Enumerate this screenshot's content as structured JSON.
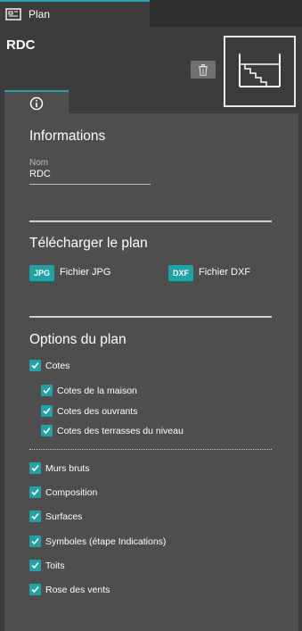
{
  "tab": {
    "label": "Plan",
    "icon": "plan-icon"
  },
  "level": {
    "title": "RDC",
    "delete_icon": "trash-icon",
    "thumbnail_icon": "floor-plan-thumbnail"
  },
  "info_tab": {
    "icon": "info-icon"
  },
  "informations": {
    "heading": "Informations",
    "name_label": "Nom",
    "name_value": "RDC"
  },
  "download": {
    "heading": "Télécharger le plan",
    "jpg_badge": "JPG",
    "jpg_label": "Fichier JPG",
    "dxf_badge": "DXF",
    "dxf_label": "Fichier DXF"
  },
  "options": {
    "heading": "Options du plan",
    "cotes": {
      "label": "Cotes",
      "checked": true
    },
    "sub": [
      {
        "label": "Cotes de la maison",
        "checked": true
      },
      {
        "label": "Cotes des ouvrants",
        "checked": true
      },
      {
        "label": "Cotes des terrasses du niveau",
        "checked": true
      }
    ],
    "others": [
      {
        "label": "Murs bruts",
        "checked": true
      },
      {
        "label": "Composition",
        "checked": true
      },
      {
        "label": "Surfaces",
        "checked": true
      },
      {
        "label": "Symboles (étape Indications)",
        "checked": true
      },
      {
        "label": "Toits",
        "checked": true
      },
      {
        "label": "Rose des vents",
        "checked": true
      }
    ]
  },
  "colors": {
    "accent": "#1fa3a6",
    "panel": "#4e4e4e",
    "background": "#3c3c3c"
  }
}
